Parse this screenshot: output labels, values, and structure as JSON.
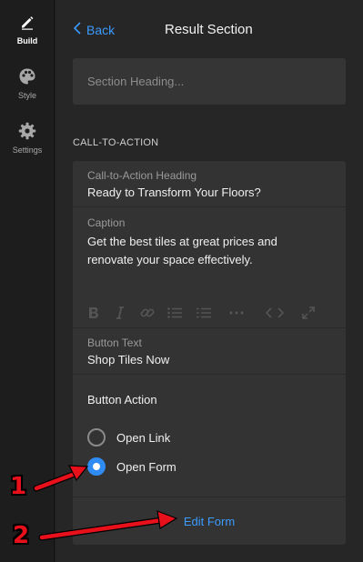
{
  "rail": {
    "items": [
      {
        "label": "Build",
        "icon": "pen-icon",
        "active": true
      },
      {
        "label": "Style",
        "icon": "palette-icon",
        "active": false
      },
      {
        "label": "Settings",
        "icon": "gear-icon",
        "active": false
      }
    ]
  },
  "header": {
    "back_label": "Back",
    "title": "Result Section"
  },
  "section_heading": {
    "placeholder": "Section Heading..."
  },
  "cta": {
    "section_label": "CALL-TO-ACTION",
    "heading_label": "Call-to-Action Heading",
    "heading_value": "Ready to Transform Your Floors?",
    "caption_label": "Caption",
    "caption_value": "Get the best tiles at great prices and renovate your space effectively.",
    "toolbar": [
      "bold-icon",
      "italic-icon",
      "link-icon",
      "bullet-list-icon",
      "numbered-list-icon",
      "more-icon",
      "code-icon",
      "expand-icon"
    ],
    "button_text_label": "Button Text",
    "button_text_value": "Shop Tiles Now",
    "button_action_label": "Button Action",
    "options": [
      {
        "label": "Open Link",
        "selected": false
      },
      {
        "label": "Open Form",
        "selected": true
      }
    ],
    "edit_form_label": "Edit Form"
  },
  "annotations": {
    "marker_1": "1",
    "marker_2": "2",
    "color": "#e8101a"
  },
  "colors": {
    "accent": "#3b9bff",
    "radio_selected": "#2f8cf2"
  }
}
